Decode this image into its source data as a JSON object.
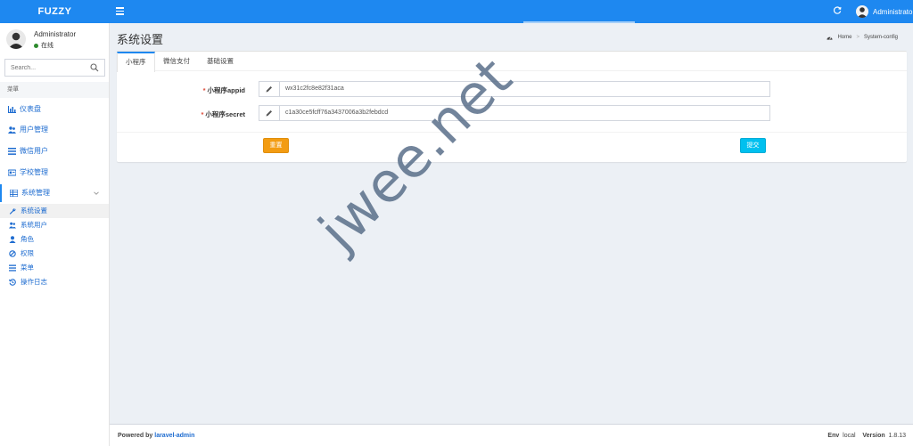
{
  "header": {
    "logo": "FUZZY",
    "user_name": "Administrator"
  },
  "sidebar": {
    "user": {
      "name": "Administrator",
      "status": "在线"
    },
    "search_placeholder": "Search...",
    "menu_header": "菜單",
    "items": [
      {
        "label": "仪表盘",
        "icon": "bar-chart-icon"
      },
      {
        "label": "用户管理",
        "icon": "users-icon"
      },
      {
        "label": "微信用户",
        "icon": "list-icon"
      },
      {
        "label": "学校管理",
        "icon": "school-icon"
      },
      {
        "label": "系统管理",
        "icon": "table-icon"
      }
    ],
    "subitems": [
      {
        "label": "系统设置",
        "icon": "wrench-icon"
      },
      {
        "label": "系統用户",
        "icon": "users-icon"
      },
      {
        "label": "角色",
        "icon": "user-icon"
      },
      {
        "label": "权限",
        "icon": "ban-icon"
      },
      {
        "label": "菜单",
        "icon": "bars-icon"
      },
      {
        "label": "操作日志",
        "icon": "history-icon"
      }
    ]
  },
  "content": {
    "title": "系统设置",
    "breadcrumb": {
      "home": "Home",
      "current": "System-config"
    },
    "tabs": [
      "小程序",
      "微信支付",
      "基础设置"
    ],
    "form": {
      "fields": [
        {
          "label": "小程序appid",
          "value": "wx31c2fc8e82f31aca"
        },
        {
          "label": "小程序secret",
          "value": "c1a30ce5fcff76a3437006a3b2febdcd"
        }
      ],
      "reset_label": "重置",
      "submit_label": "提交"
    }
  },
  "watermark": "jwee.net",
  "footer": {
    "powered_prefix": "Powered by",
    "powered_link": "laravel-admin",
    "env_label": "Env",
    "env_value": "local",
    "version_label": "Version",
    "version_value": "1.8.13"
  },
  "colors": {
    "header_blue": "#1e88f0",
    "link_blue": "#1e6cd0",
    "reset_orange": "#f39c12",
    "submit_cyan": "#00c0ef",
    "required_red": "#dd4b39",
    "online_green": "#2e8b2e"
  }
}
